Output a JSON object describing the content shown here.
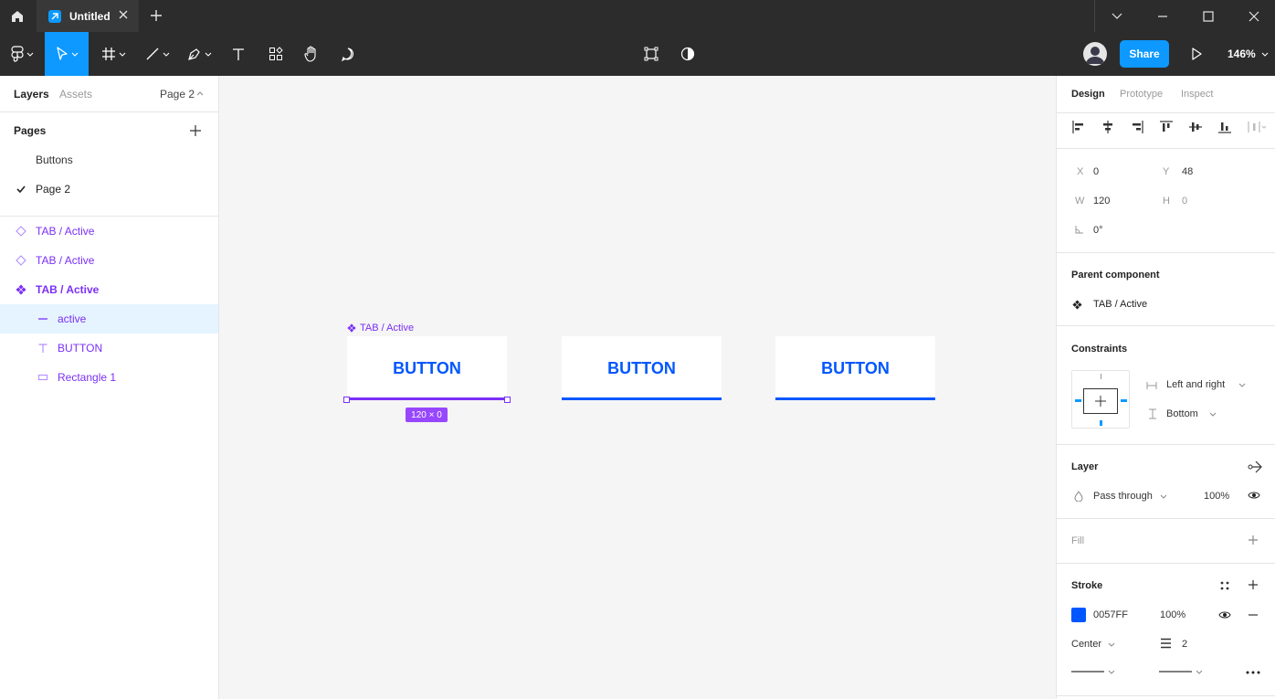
{
  "window": {
    "tab_title": "Untitled"
  },
  "toolbar": {
    "share_label": "Share",
    "zoom": "146%"
  },
  "left_panel": {
    "tabs": [
      "Layers",
      "Assets"
    ],
    "page_selector": "Page 2",
    "pages_header": "Pages",
    "pages": [
      {
        "label": "Buttons",
        "current": false
      },
      {
        "label": "Page 2",
        "current": true
      }
    ],
    "layers": [
      {
        "label": "TAB / Active",
        "icon": "component-variant-icon"
      },
      {
        "label": "TAB / Active",
        "icon": "component-variant-icon"
      },
      {
        "label": "TAB / Active",
        "icon": "component-main-icon"
      },
      {
        "label": "active",
        "icon": "line-icon"
      },
      {
        "label": "BUTTON",
        "icon": "text-icon"
      },
      {
        "label": "Rectangle 1",
        "icon": "rectangle-icon"
      }
    ]
  },
  "canvas": {
    "selected_label": "TAB / Active",
    "buttons": [
      "BUTTON",
      "BUTTON",
      "BUTTON"
    ],
    "dimension_badge": "120 × 0",
    "accent_color": "#0057ff",
    "selection_color": "#9747ff"
  },
  "right_panel": {
    "tabs": [
      "Design",
      "Prototype",
      "Inspect"
    ],
    "x_label": "X",
    "x_value": "0",
    "y_label": "Y",
    "y_value": "48",
    "w_label": "W",
    "w_value": "120",
    "h_label": "H",
    "h_value": "0",
    "rotation": "0°",
    "parent_component_title": "Parent component",
    "parent_component_name": "TAB / Active",
    "constraints_title": "Constraints",
    "constraint_horizontal": "Left and right",
    "constraint_vertical": "Bottom",
    "layer_title": "Layer",
    "blend_mode": "Pass through",
    "layer_opacity": "100%",
    "fill_title": "Fill",
    "stroke_title": "Stroke",
    "stroke_hex": "0057FF",
    "stroke_opacity": "100%",
    "stroke_position": "Center",
    "stroke_weight": "2"
  }
}
